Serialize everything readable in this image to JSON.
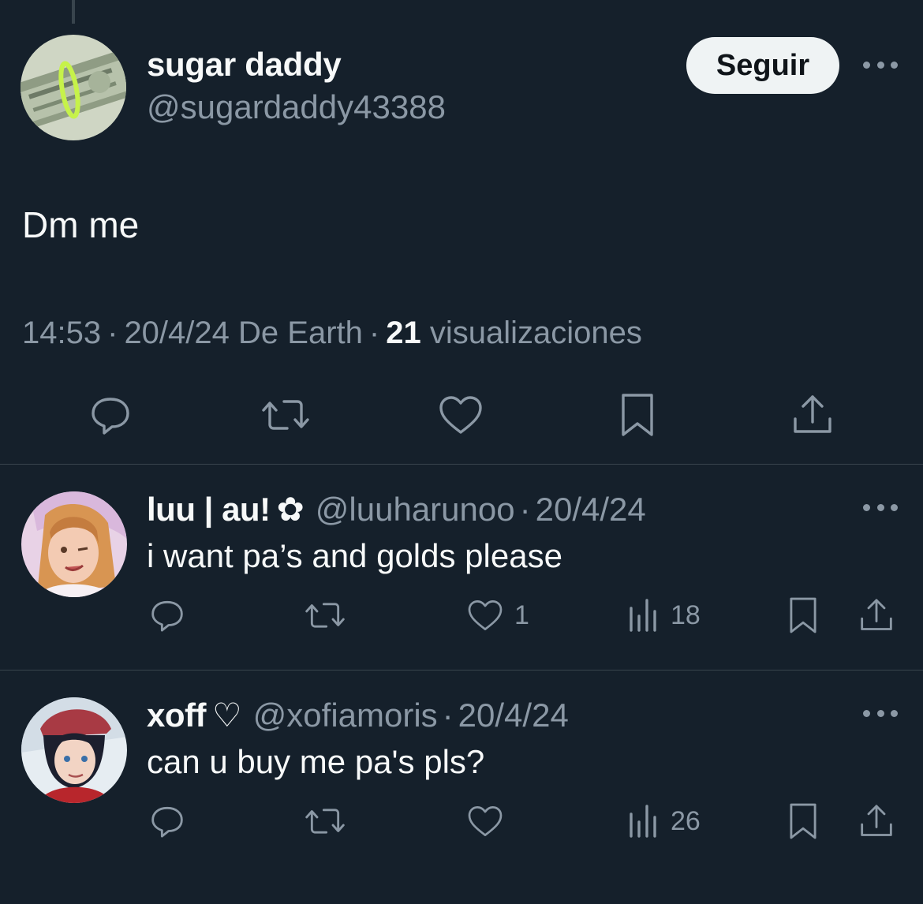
{
  "main_tweet": {
    "author_name": "sugar daddy",
    "author_handle": "@sugardaddy43388",
    "follow_label": "Seguir",
    "text": "Dm me",
    "time": "14:53",
    "date": "20/4/24",
    "source": "De Earth",
    "separator": "·",
    "views_count": "21",
    "views_label": "visualizaciones",
    "actions": [
      "reply-icon",
      "retweet-icon",
      "like-icon",
      "bookmark-icon",
      "share-icon"
    ]
  },
  "replies": [
    {
      "name": "luu | au!",
      "name_extra": "✿",
      "handle": "@luuharunoo",
      "separator": "·",
      "date": "20/4/24",
      "text": "i want pa’s and golds please",
      "like_count": "1",
      "views_count": "18"
    },
    {
      "name": "xoff",
      "name_extra": "♡",
      "handle": "@xofiamoris",
      "separator": "·",
      "date": "20/4/24",
      "text": "can u buy me pa's pls?",
      "like_count": "",
      "views_count": "26"
    }
  ],
  "colors": {
    "background": "#15202b",
    "text_primary": "#f7f9f9",
    "text_secondary": "#8b98a5",
    "divider": "#38444d",
    "follow_button_bg": "#eff3f4"
  }
}
